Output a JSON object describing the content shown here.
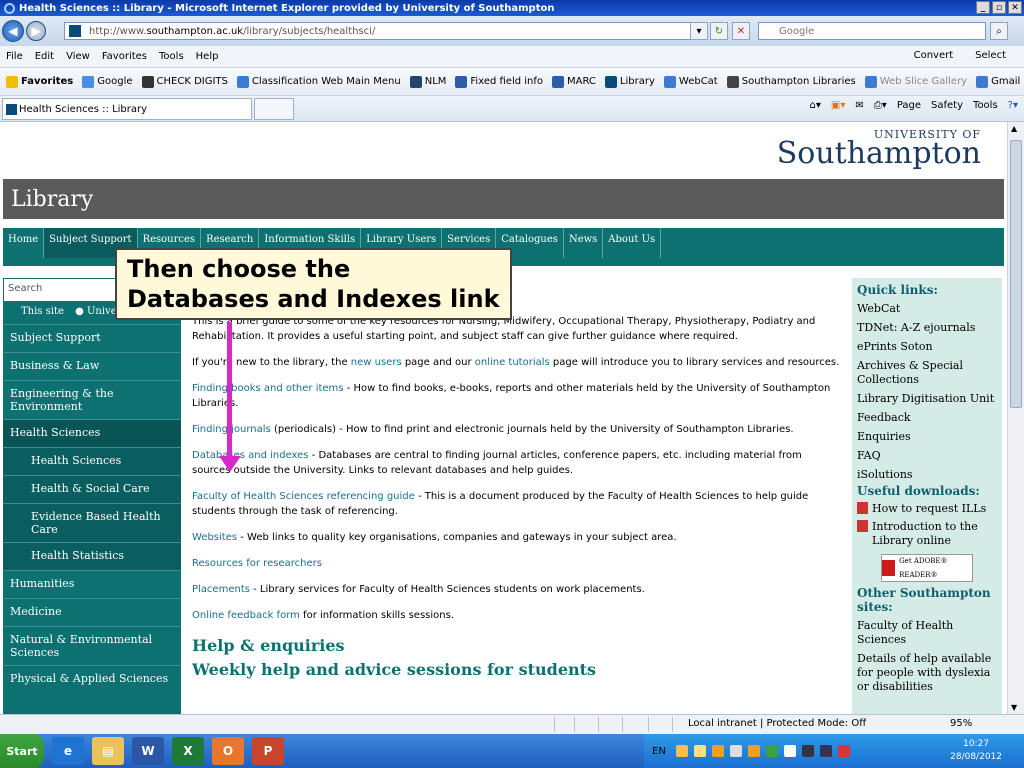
{
  "window": {
    "title": "Health Sciences :: Library - Microsoft Internet Explorer provided by University of Southampton"
  },
  "address": {
    "url_prefix": "http://www.",
    "url_domain": "southampton.ac.uk",
    "url_path": "/library/subjects/healthsci/",
    "search_placeholder": "Google"
  },
  "menubar": {
    "items": [
      "File",
      "Edit",
      "View",
      "Favorites",
      "Tools",
      "Help"
    ],
    "convert": "Convert",
    "select": "Select"
  },
  "favorites": {
    "label": "Favorites",
    "items": [
      "Google",
      "CHECK DIGITS",
      "Classification Web Main Menu",
      "NLM",
      "Fixed field info",
      "MARC",
      "Library",
      "WebCat",
      "Southampton Libraries",
      "Web Slice Gallery",
      "Gmail"
    ]
  },
  "tab": {
    "title": "Health Sciences :: Library"
  },
  "commands": {
    "page": "Page",
    "safety": "Safety",
    "tools": "Tools"
  },
  "site": {
    "logo_top": "UNIVERSITY OF",
    "logo_main": "Southampton",
    "banner": "Library",
    "topnav": [
      "Home",
      "Subject Support",
      "Resources",
      "Research",
      "Information Skills",
      "Library Users",
      "Services",
      "Catalogues",
      "News",
      "About Us"
    ],
    "search_placeholder": "Search",
    "radio_this_site": "This site",
    "radio_university": "University",
    "leftnav": [
      "Subject Support",
      "Business & Law",
      "Engineering & the Environment",
      "Health Sciences",
      "Health Sciences",
      "Health & Social Care",
      "Evidence Based Health Care",
      "Health Statistics",
      "Humanities",
      "Medicine",
      "Natural & Environmental Sciences",
      "Physical & Applied Sciences"
    ]
  },
  "content": {
    "intro": "This is a brief guide to some of the key resources for Nursing, Midwifery, Occupational Therapy, Physiotherapy, Podiatry and Rehabilitation. It provides a useful starting point, and subject staff can give further guidance where required.",
    "new_users_pre": "If you're new to the library, the ",
    "new_users_link": "new users",
    "new_users_mid": " page and our ",
    "tutorials_link": "online tutorials",
    "new_users_post": " page will introduce you to library services and resources.",
    "books_link": "Finding books and other items",
    "books_text": " - How to find books, e-books, reports and other materials held by the University of Southampton Libraries.",
    "journals_link": "Finding journals",
    "journals_text": " (periodicals) - How to find print and electronic journals held by the University of Southampton Libraries.",
    "db_link": "Databases and indexes",
    "db_text": " - Databases are central to finding journal articles, conference papers, etc. including material from sources outside the University. Links to relevant databases and help guides.",
    "ref_link": "Faculty of Health Sciences referencing guide",
    "ref_text": " - This is a document produced by the Faculty of Health Sciences to help guide students through the task of referencing.",
    "web_link": "Websites",
    "web_text": " - Web links to quality key organisations, companies and gateways in your subject area.",
    "research_link": "Resources for researchers",
    "place_link": "Placements",
    "place_text": " - Library services for Faculty of Health Sciences students on work placements.",
    "feedback_link": "Online feedback form",
    "feedback_text": " for information skills sessions.",
    "h_help": "Help & enquiries",
    "h_weekly": "Weekly help and advice sessions for students"
  },
  "right": {
    "quick_title": "Quick links:",
    "quick": [
      "WebCat",
      "TDNet: A-Z ejournals",
      "ePrints Soton",
      "Archives & Special Collections",
      "Library Digitisation Unit",
      "Feedback",
      "Enquiries",
      "FAQ",
      "iSolutions"
    ],
    "downloads_title": "Useful downloads:",
    "downloads": [
      "How to request ILLs",
      "Introduction to the Library online"
    ],
    "adobe": "Get ADOBE® READER®",
    "other_title": "Other Southampton sites:",
    "other": [
      "Faculty of Health Sciences",
      "Details of help available for people with dyslexia or disabilities"
    ]
  },
  "callout": {
    "text": "Then choose the Databases and Indexes link",
    "arrow_color": "#d829c7"
  },
  "status": {
    "zone": "Local intranet | Protected Mode: Off",
    "zoom": "95%"
  },
  "taskbar": {
    "start": "Start",
    "lang": "EN",
    "time": "10:27",
    "date": "28/08/2012"
  }
}
